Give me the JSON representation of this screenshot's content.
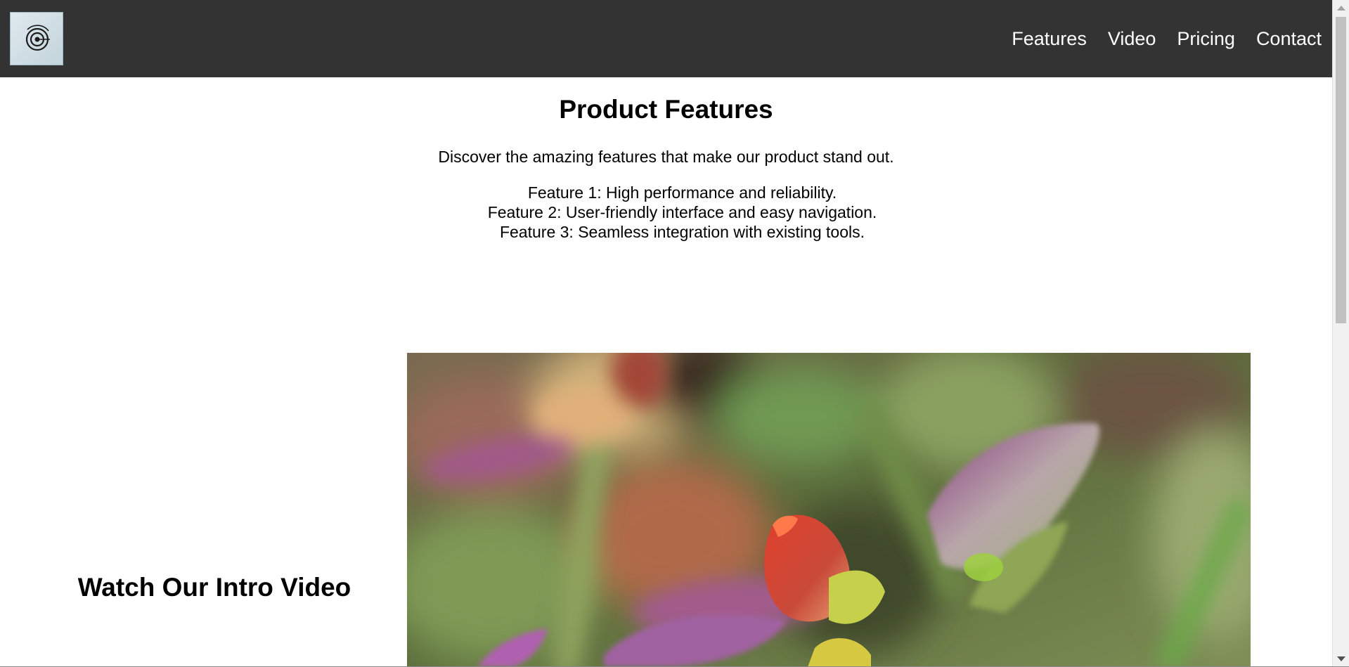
{
  "header": {
    "logo_icon": "concentric-circles-logo",
    "nav": [
      {
        "label": "Features"
      },
      {
        "label": "Video"
      },
      {
        "label": "Pricing"
      },
      {
        "label": "Contact"
      }
    ]
  },
  "features": {
    "title": "Product Features",
    "intro": "Discover the amazing features that make our product stand out.",
    "items": [
      "Feature 1: High performance and reliability.",
      "Feature 2: User-friendly interface and easy navigation.",
      "Feature 3: Seamless integration with existing tools."
    ]
  },
  "video": {
    "title": "Watch Our Intro Video",
    "thumbnail_subject": "macro photo of a red bud among purple-green succulent leaves"
  },
  "colors": {
    "header_bg": "#333333",
    "nav_text": "#ffffff",
    "page_bg": "#ffffff"
  }
}
